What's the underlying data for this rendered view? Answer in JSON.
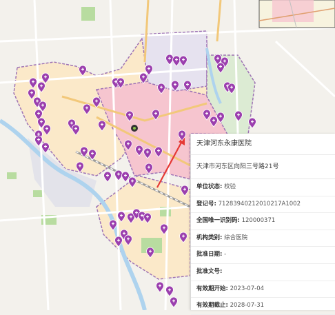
{
  "map": {
    "pin_color": "#9b3fae",
    "accent_arrow_color": "#e53935",
    "highlight_region_color": "#f7c9d3",
    "icons": [
      "map-pin-icon",
      "inset-map"
    ]
  },
  "info_panel": {
    "name": "天津河东永康医院",
    "address": "天津市河东区向阳三号路21号",
    "fields": [
      {
        "label": "单位状态:",
        "value": "校验"
      },
      {
        "label": "登记号:",
        "value": "71283940212010217A1002"
      },
      {
        "label": "全国唯一识别码:",
        "value": "120000371"
      },
      {
        "label": "机构类别:",
        "value": "综合医院"
      },
      {
        "label": "批准日期:",
        "value": "-"
      },
      {
        "label": "批准文号:",
        "value": ""
      },
      {
        "label": "有效期开始:",
        "value": "2023-07-04"
      },
      {
        "label": "有效期截止:",
        "value": "2028-07-31"
      }
    ]
  }
}
